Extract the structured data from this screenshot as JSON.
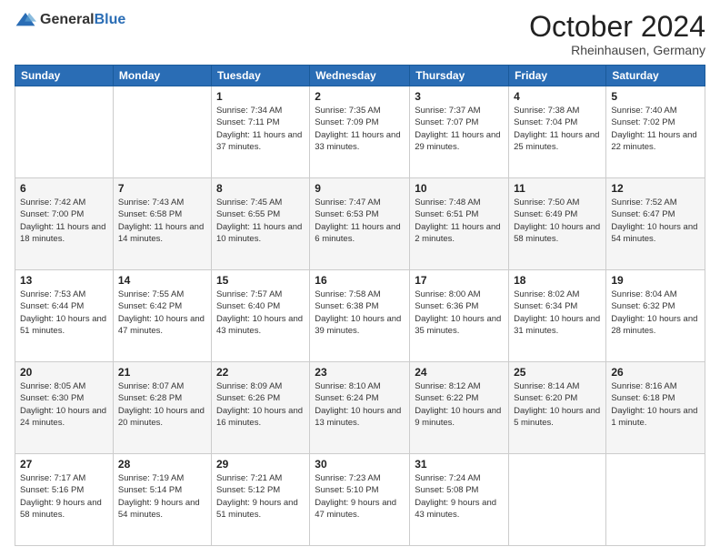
{
  "header": {
    "logo_general": "General",
    "logo_blue": "Blue",
    "title": "October 2024",
    "location": "Rheinhausen, Germany"
  },
  "weekdays": [
    "Sunday",
    "Monday",
    "Tuesday",
    "Wednesday",
    "Thursday",
    "Friday",
    "Saturday"
  ],
  "weeks": [
    [
      {
        "day": "",
        "sunrise": "",
        "sunset": "",
        "daylight": ""
      },
      {
        "day": "",
        "sunrise": "",
        "sunset": "",
        "daylight": ""
      },
      {
        "day": "1",
        "sunrise": "Sunrise: 7:34 AM",
        "sunset": "Sunset: 7:11 PM",
        "daylight": "Daylight: 11 hours and 37 minutes."
      },
      {
        "day": "2",
        "sunrise": "Sunrise: 7:35 AM",
        "sunset": "Sunset: 7:09 PM",
        "daylight": "Daylight: 11 hours and 33 minutes."
      },
      {
        "day": "3",
        "sunrise": "Sunrise: 7:37 AM",
        "sunset": "Sunset: 7:07 PM",
        "daylight": "Daylight: 11 hours and 29 minutes."
      },
      {
        "day": "4",
        "sunrise": "Sunrise: 7:38 AM",
        "sunset": "Sunset: 7:04 PM",
        "daylight": "Daylight: 11 hours and 25 minutes."
      },
      {
        "day": "5",
        "sunrise": "Sunrise: 7:40 AM",
        "sunset": "Sunset: 7:02 PM",
        "daylight": "Daylight: 11 hours and 22 minutes."
      }
    ],
    [
      {
        "day": "6",
        "sunrise": "Sunrise: 7:42 AM",
        "sunset": "Sunset: 7:00 PM",
        "daylight": "Daylight: 11 hours and 18 minutes."
      },
      {
        "day": "7",
        "sunrise": "Sunrise: 7:43 AM",
        "sunset": "Sunset: 6:58 PM",
        "daylight": "Daylight: 11 hours and 14 minutes."
      },
      {
        "day": "8",
        "sunrise": "Sunrise: 7:45 AM",
        "sunset": "Sunset: 6:55 PM",
        "daylight": "Daylight: 11 hours and 10 minutes."
      },
      {
        "day": "9",
        "sunrise": "Sunrise: 7:47 AM",
        "sunset": "Sunset: 6:53 PM",
        "daylight": "Daylight: 11 hours and 6 minutes."
      },
      {
        "day": "10",
        "sunrise": "Sunrise: 7:48 AM",
        "sunset": "Sunset: 6:51 PM",
        "daylight": "Daylight: 11 hours and 2 minutes."
      },
      {
        "day": "11",
        "sunrise": "Sunrise: 7:50 AM",
        "sunset": "Sunset: 6:49 PM",
        "daylight": "Daylight: 10 hours and 58 minutes."
      },
      {
        "day": "12",
        "sunrise": "Sunrise: 7:52 AM",
        "sunset": "Sunset: 6:47 PM",
        "daylight": "Daylight: 10 hours and 54 minutes."
      }
    ],
    [
      {
        "day": "13",
        "sunrise": "Sunrise: 7:53 AM",
        "sunset": "Sunset: 6:44 PM",
        "daylight": "Daylight: 10 hours and 51 minutes."
      },
      {
        "day": "14",
        "sunrise": "Sunrise: 7:55 AM",
        "sunset": "Sunset: 6:42 PM",
        "daylight": "Daylight: 10 hours and 47 minutes."
      },
      {
        "day": "15",
        "sunrise": "Sunrise: 7:57 AM",
        "sunset": "Sunset: 6:40 PM",
        "daylight": "Daylight: 10 hours and 43 minutes."
      },
      {
        "day": "16",
        "sunrise": "Sunrise: 7:58 AM",
        "sunset": "Sunset: 6:38 PM",
        "daylight": "Daylight: 10 hours and 39 minutes."
      },
      {
        "day": "17",
        "sunrise": "Sunrise: 8:00 AM",
        "sunset": "Sunset: 6:36 PM",
        "daylight": "Daylight: 10 hours and 35 minutes."
      },
      {
        "day": "18",
        "sunrise": "Sunrise: 8:02 AM",
        "sunset": "Sunset: 6:34 PM",
        "daylight": "Daylight: 10 hours and 31 minutes."
      },
      {
        "day": "19",
        "sunrise": "Sunrise: 8:04 AM",
        "sunset": "Sunset: 6:32 PM",
        "daylight": "Daylight: 10 hours and 28 minutes."
      }
    ],
    [
      {
        "day": "20",
        "sunrise": "Sunrise: 8:05 AM",
        "sunset": "Sunset: 6:30 PM",
        "daylight": "Daylight: 10 hours and 24 minutes."
      },
      {
        "day": "21",
        "sunrise": "Sunrise: 8:07 AM",
        "sunset": "Sunset: 6:28 PM",
        "daylight": "Daylight: 10 hours and 20 minutes."
      },
      {
        "day": "22",
        "sunrise": "Sunrise: 8:09 AM",
        "sunset": "Sunset: 6:26 PM",
        "daylight": "Daylight: 10 hours and 16 minutes."
      },
      {
        "day": "23",
        "sunrise": "Sunrise: 8:10 AM",
        "sunset": "Sunset: 6:24 PM",
        "daylight": "Daylight: 10 hours and 13 minutes."
      },
      {
        "day": "24",
        "sunrise": "Sunrise: 8:12 AM",
        "sunset": "Sunset: 6:22 PM",
        "daylight": "Daylight: 10 hours and 9 minutes."
      },
      {
        "day": "25",
        "sunrise": "Sunrise: 8:14 AM",
        "sunset": "Sunset: 6:20 PM",
        "daylight": "Daylight: 10 hours and 5 minutes."
      },
      {
        "day": "26",
        "sunrise": "Sunrise: 8:16 AM",
        "sunset": "Sunset: 6:18 PM",
        "daylight": "Daylight: 10 hours and 1 minute."
      }
    ],
    [
      {
        "day": "27",
        "sunrise": "Sunrise: 7:17 AM",
        "sunset": "Sunset: 5:16 PM",
        "daylight": "Daylight: 9 hours and 58 minutes."
      },
      {
        "day": "28",
        "sunrise": "Sunrise: 7:19 AM",
        "sunset": "Sunset: 5:14 PM",
        "daylight": "Daylight: 9 hours and 54 minutes."
      },
      {
        "day": "29",
        "sunrise": "Sunrise: 7:21 AM",
        "sunset": "Sunset: 5:12 PM",
        "daylight": "Daylight: 9 hours and 51 minutes."
      },
      {
        "day": "30",
        "sunrise": "Sunrise: 7:23 AM",
        "sunset": "Sunset: 5:10 PM",
        "daylight": "Daylight: 9 hours and 47 minutes."
      },
      {
        "day": "31",
        "sunrise": "Sunrise: 7:24 AM",
        "sunset": "Sunset: 5:08 PM",
        "daylight": "Daylight: 9 hours and 43 minutes."
      },
      {
        "day": "",
        "sunrise": "",
        "sunset": "",
        "daylight": ""
      },
      {
        "day": "",
        "sunrise": "",
        "sunset": "",
        "daylight": ""
      }
    ]
  ]
}
